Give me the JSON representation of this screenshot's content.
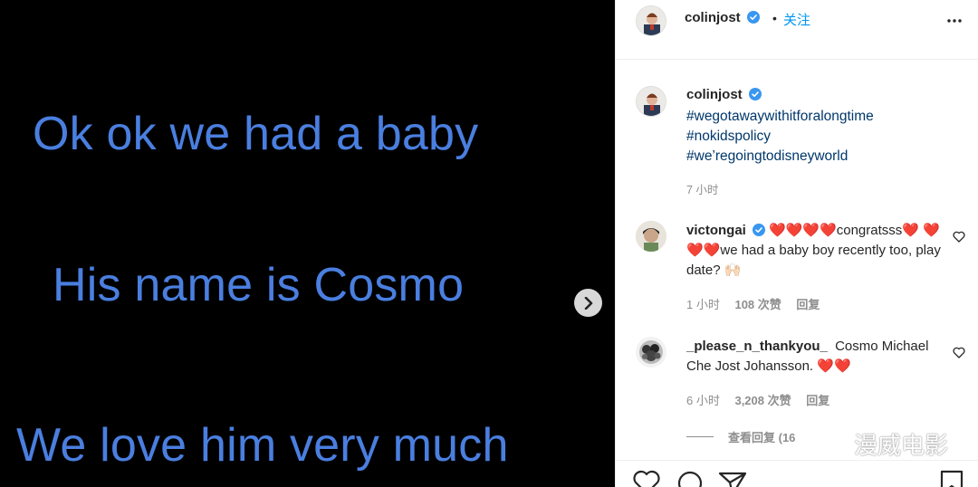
{
  "media": {
    "lines": [
      "Ok ok we had a baby",
      "His name is Cosmo",
      "We love him very much"
    ]
  },
  "header": {
    "username": "colinjost",
    "separator": "•",
    "follow_label": "关注"
  },
  "caption": {
    "username": "colinjost",
    "hashtags": [
      "#wegotawaywithitforalongtime",
      "#nokidspolicy",
      "#we’regoingtodisneyworld"
    ],
    "time": "7 小时"
  },
  "comments": [
    {
      "username": "victongai",
      "text_parts": [
        "❤️❤️❤️❤️",
        "congratsss",
        "❤️",
        "❤️❤️❤️",
        "we had a baby boy recently too, play date? 🙌🏻"
      ],
      "time": "1 小时",
      "likes": "108 次赞",
      "reply_label": "回复"
    },
    {
      "username": "_please_n_thankyou_",
      "text_parts": [
        "Cosmo Michael Che Jost Johansson. ",
        "❤️❤️"
      ],
      "time": "6 小时",
      "likes": "3,208 次赞",
      "reply_label": "回复"
    }
  ],
  "view_replies_label": "查看回复 (16",
  "watermark": "漫威电影",
  "icons": [
    "verified-badge-icon",
    "more-options-icon",
    "heart-outline-icon",
    "comment-icon",
    "share-icon",
    "bookmark-icon",
    "chevron-right-icon"
  ],
  "colors": {
    "accent": "#0095f6",
    "hashtag": "#00376b",
    "media_text": "#4a7fe0",
    "muted": "#8e8e8e"
  }
}
